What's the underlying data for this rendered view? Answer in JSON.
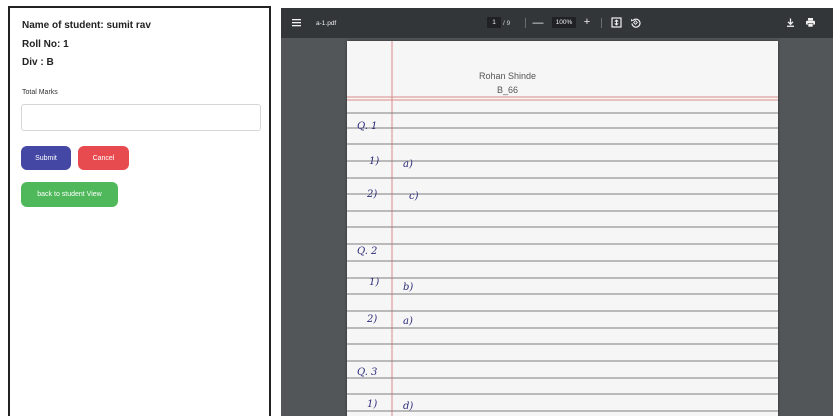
{
  "student": {
    "name_line": "Name of student: sumit rav",
    "roll_line": "Roll No: 1",
    "div_line": "Div : B"
  },
  "form": {
    "marks_label": "Total Marks",
    "marks_value": "",
    "submit_label": "Submit",
    "cancel_label": "Cancel",
    "back_label": "back to student View"
  },
  "colors": {
    "submit": "#4547a5",
    "cancel": "#e84b4f",
    "back": "#4eb85a",
    "viewer_toolbar": "#323639",
    "viewer_bg": "#525659"
  },
  "viewer": {
    "file_name": "a-1.pdf",
    "page_current": "1",
    "page_total": "/ 9",
    "zoom_minus": "—",
    "zoom": "100%",
    "zoom_plus": "+",
    "icons": [
      "menu-icon",
      "fit-page-icon",
      "rotate-icon",
      "download-icon",
      "print-icon"
    ]
  },
  "document": {
    "header_name": "Rohan Shinde",
    "header_roll": "B_66",
    "handwriting": {
      "q1": "Q. 1",
      "q1_1_num": "1)",
      "q1_1_ans": "a)",
      "q1_2_num": "2)",
      "q1_2_ans": "c)",
      "q2": "Q. 2",
      "q2_1_num": "1)",
      "q2_1_ans": "b)",
      "q2_2_num": "2)",
      "q2_2_ans": "a)",
      "q3": "Q. 3",
      "q3_1_num": "1)",
      "q3_1_ans": "d)"
    }
  }
}
